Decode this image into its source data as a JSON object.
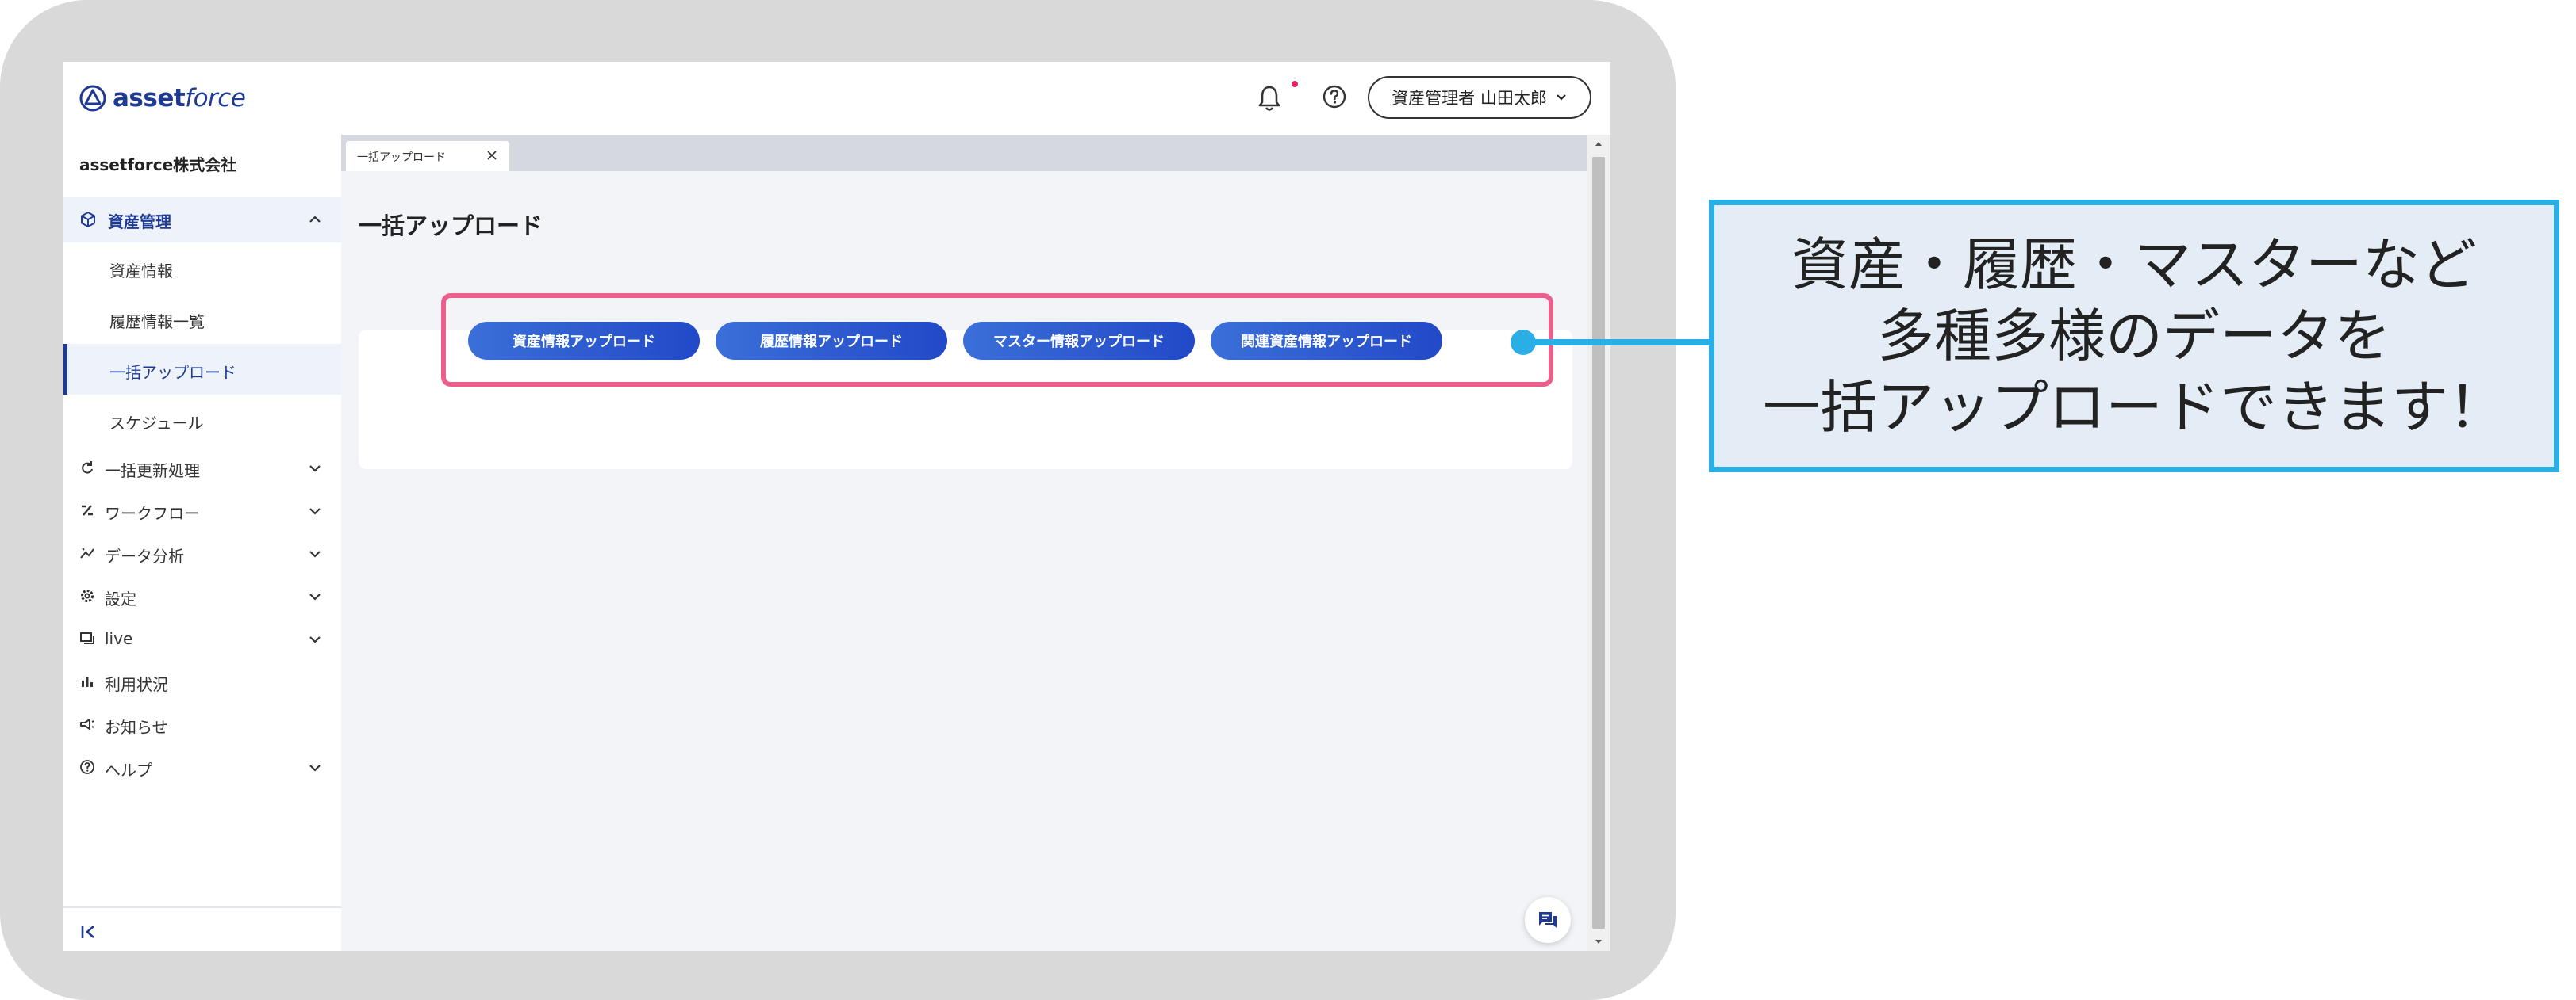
{
  "brand": {
    "name": "asset",
    "name_suffix": "force",
    "color": "#1f3a93"
  },
  "header": {
    "user_label": "資産管理者 山田太郎",
    "notification_icon": "bell-icon",
    "help_icon": "question-circle-icon"
  },
  "sidebar": {
    "company": "assetforce株式会社",
    "section": {
      "label": "資産管理",
      "icon": "cube-icon",
      "items": [
        {
          "label": "資産情報"
        },
        {
          "label": "履歴情報一覧"
        },
        {
          "label": "一括アップロード",
          "active": true
        },
        {
          "label": "スケジュール"
        }
      ]
    },
    "nav": [
      {
        "label": "一括更新処理",
        "icon": "refresh-icon",
        "expandable": true
      },
      {
        "label": "ワークフロー",
        "icon": "workflow-icon",
        "expandable": true
      },
      {
        "label": "データ分析",
        "icon": "analytics-icon",
        "expandable": true
      },
      {
        "label": "設定",
        "icon": "gear-icon",
        "expandable": true
      },
      {
        "label": "live",
        "icon": "live-icon",
        "expandable": true
      },
      {
        "label": "利用状況",
        "icon": "bar-chart-icon",
        "expandable": false
      },
      {
        "label": "お知らせ",
        "icon": "megaphone-icon",
        "expandable": false
      },
      {
        "label": "ヘルプ",
        "icon": "question-circle-icon",
        "expandable": true
      }
    ]
  },
  "main": {
    "tab_label": "一括アップロード",
    "title": "一括アップロード",
    "buttons": [
      {
        "label": "資産情報アップロード"
      },
      {
        "label": "履歴情報アップロード"
      },
      {
        "label": "マスター情報アップロード"
      },
      {
        "label": "関連資産情報アップロード"
      }
    ]
  },
  "callout": {
    "lines": [
      "資産・履歴・マスターなど",
      "多種多様のデータを",
      "一括アップロードできます！"
    ],
    "border_color": "#2aaee6",
    "highlight_color": "#ec5f8b"
  }
}
